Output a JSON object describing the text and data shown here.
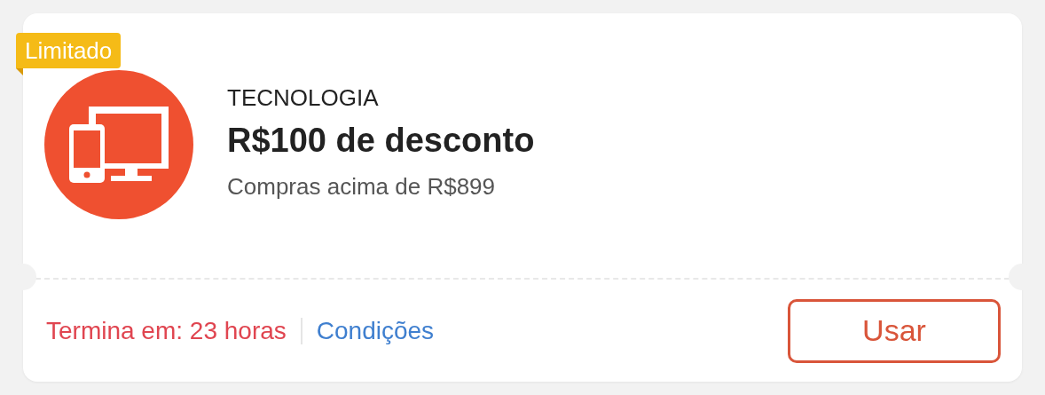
{
  "coupon": {
    "badge": "Limitado",
    "category": "TECNOLOGIA",
    "title": "R$100 de desconto",
    "condition": "Compras acima de R$899",
    "expiry": "Termina em: 23 horas",
    "terms_link": "Condições",
    "button": "Usar"
  }
}
